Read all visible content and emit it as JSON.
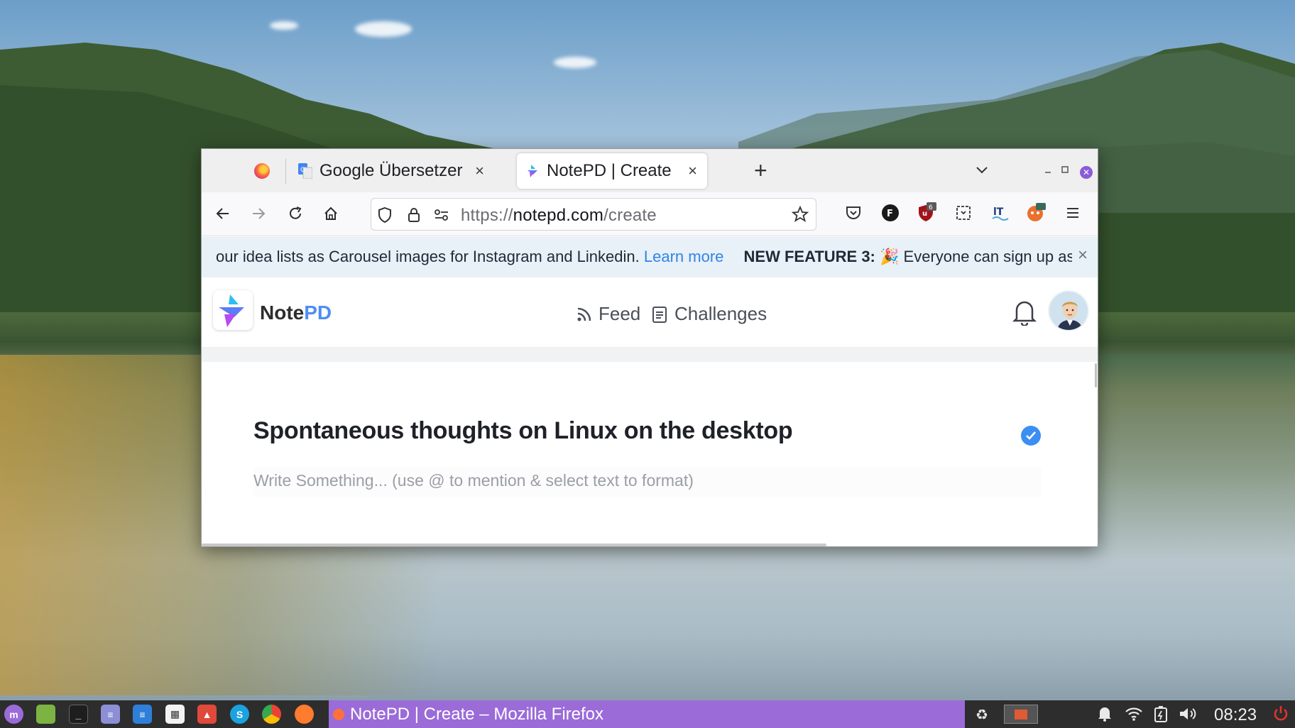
{
  "browser": {
    "tabs": [
      {
        "label": "Google Übersetzer",
        "close": "×"
      },
      {
        "label": "NotePD | Create",
        "close": "×"
      }
    ],
    "new_tab": "+",
    "url": {
      "scheme": "https://",
      "host": "notepd.com",
      "path": "/create"
    },
    "ublock_badge": "6"
  },
  "banner": {
    "text": "our idea lists as Carousel images for Instagram and Linkedin.",
    "link": "Learn more",
    "feature_label": "NEW FEATURE 3:",
    "feature_emoji": "🎉",
    "feature_text": "Everyone can sign up as p",
    "close": "×"
  },
  "site": {
    "brand_a": "Note",
    "brand_b": "PD",
    "nav": [
      {
        "label": "Feed",
        "icon": "rss-icon"
      },
      {
        "label": "Challenges",
        "icon": "clipboard-icon"
      }
    ]
  },
  "editor": {
    "title": "Spontaneous thoughts on Linux on the desktop",
    "placeholder": "Write Something... (use @ to mention & select text to format)"
  },
  "taskbar": {
    "active_task": "NotePD | Create – Mozilla Firefox",
    "clock": "08:23"
  },
  "colors": {
    "accent": "#4d8ef5",
    "link": "#2f86e6",
    "taskbar_active": "#9b6bd8",
    "banner_bg": "#e8f0f8"
  }
}
